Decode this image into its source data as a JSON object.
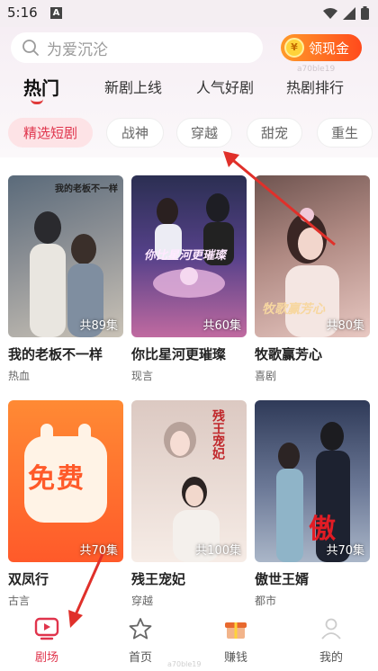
{
  "status_bar": {
    "time": "5:16",
    "notif_glyph": "A"
  },
  "search": {
    "placeholder": "为爱沉沦"
  },
  "reward_button": {
    "label": "领现金",
    "coin_glyph": "¥"
  },
  "watermark_top": "a70ble19",
  "tabs": [
    {
      "label": "热门",
      "active": true
    },
    {
      "label": "新剧上线"
    },
    {
      "label": "人气好剧"
    },
    {
      "label": "热剧排行"
    }
  ],
  "chips": [
    {
      "label": "精选短剧",
      "active": true
    },
    {
      "label": "战神"
    },
    {
      "label": "穿越"
    },
    {
      "label": "甜宠"
    },
    {
      "label": "重生"
    }
  ],
  "dramas": [
    {
      "title": "我的老板不一样",
      "tag": "热血",
      "episodes": "共89集",
      "poster_text": "我的老板不一样",
      "colors": [
        "#5a6a7a",
        "#c9c2b6"
      ]
    },
    {
      "title": "你比星河更璀璨",
      "tag": "现言",
      "episodes": "共60集",
      "poster_text": "你比星河更璀璨",
      "colors": [
        "#3c3a6e",
        "#c06aa0"
      ]
    },
    {
      "title": "牧歌赢芳心",
      "tag": "喜剧",
      "episodes": "共80集",
      "poster_text": "牧歌赢芳心",
      "colors": [
        "#7a5c58",
        "#e8c8c2"
      ]
    },
    {
      "title": "双凤行",
      "tag": "古言",
      "episodes": "共70集",
      "poster_text": "免费",
      "colors": [
        "#ff7a2a",
        "#ff4a2e"
      ]
    },
    {
      "title": "残王宠妃",
      "tag": "穿越",
      "episodes": "共100集",
      "poster_text": "残王宠妃",
      "colors": [
        "#e2d3cd",
        "#f6ece6"
      ]
    },
    {
      "title": "傲世王婿",
      "tag": "都市",
      "episodes": "共70集",
      "poster_text": "傲",
      "colors": [
        "#3c4a6a",
        "#aab6c8"
      ]
    }
  ],
  "bottom_nav": [
    {
      "label": "剧场",
      "icon": "play-square-icon",
      "active": true
    },
    {
      "label": "首页",
      "icon": "star-icon"
    },
    {
      "label": "赚钱",
      "icon": "gift-icon"
    },
    {
      "label": "我的",
      "icon": "user-icon"
    }
  ],
  "watermark_bottom": "a70ble19",
  "colors": {
    "accent": "#e0344c",
    "reward_start": "#ff9a2a",
    "reward_end": "#ff4a1c"
  }
}
